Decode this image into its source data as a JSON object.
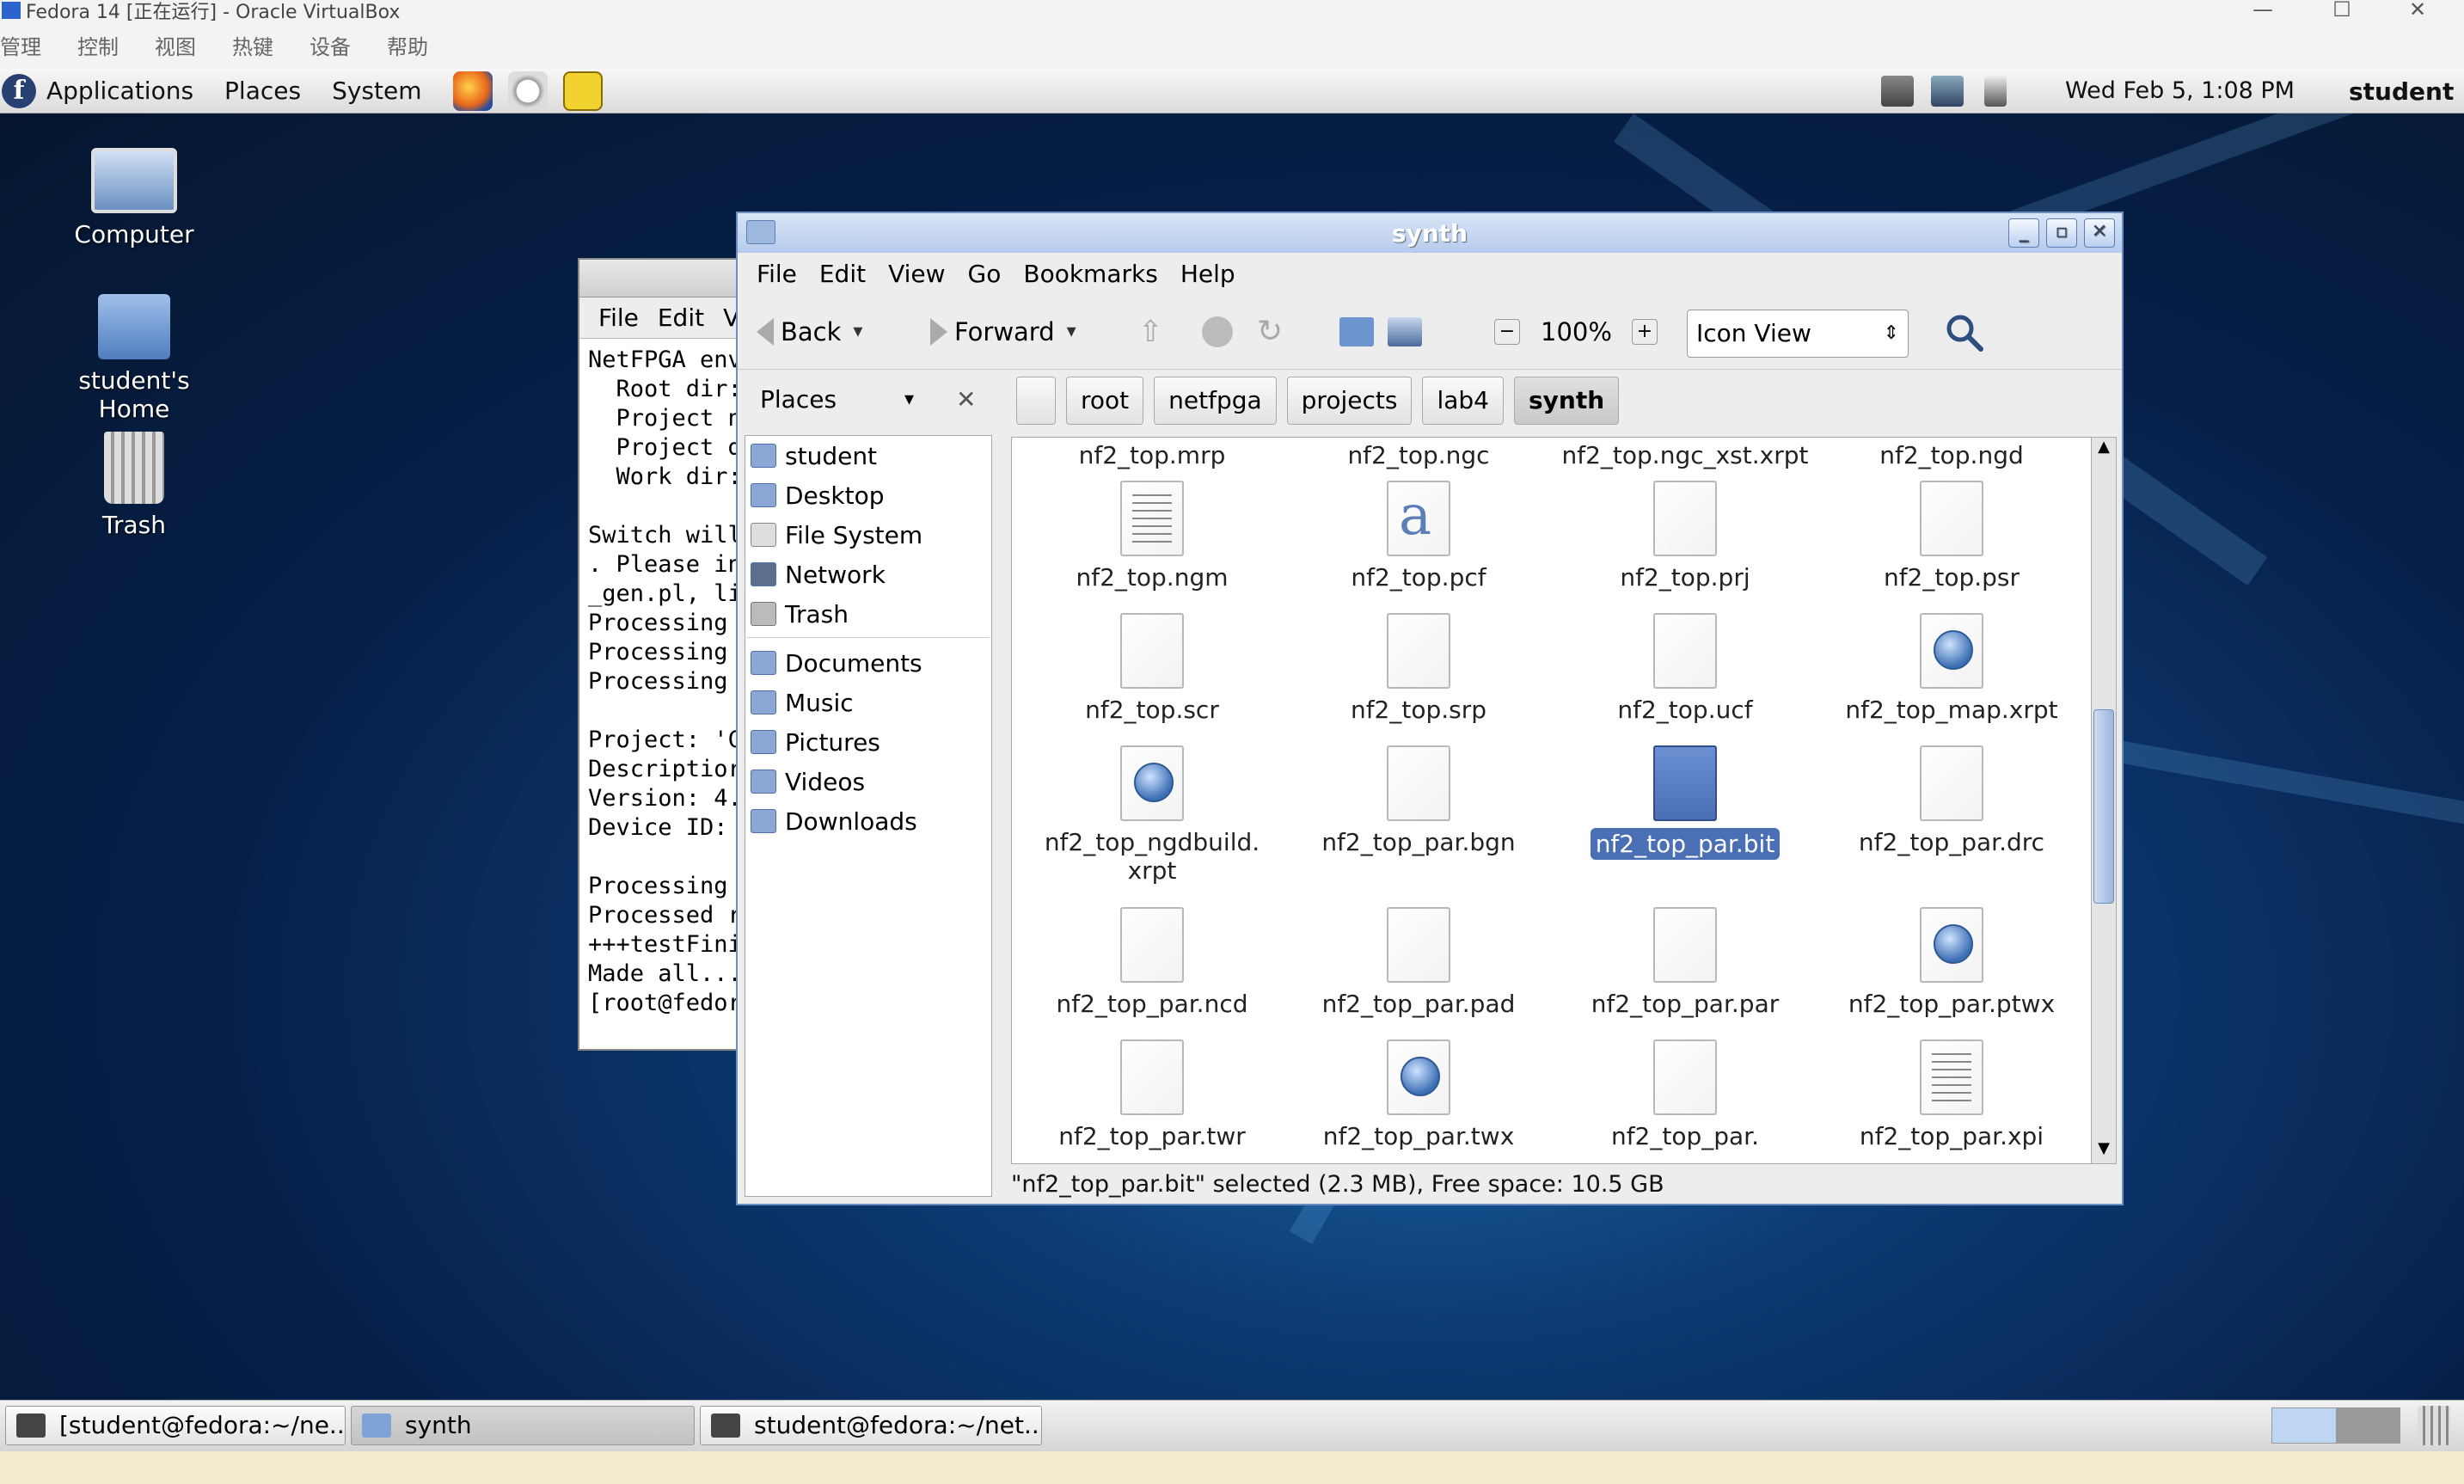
{
  "vbox": {
    "title": "Fedora 14 [正在运行] - Oracle VirtualBox",
    "menu": [
      "管理",
      "控制",
      "视图",
      "热键",
      "设备",
      "帮助"
    ]
  },
  "panel": {
    "menus": [
      "Applications",
      "Places",
      "System"
    ],
    "clock": "Wed Feb  5,  1:08 PM",
    "user": "student"
  },
  "desktop_icons": [
    "Computer",
    "student's Home",
    "Trash"
  ],
  "terminal": {
    "menu": [
      "File",
      "Edit",
      "V"
    ],
    "lines": [
      "NetFPGA env",
      "  Root dir:",
      "  Project n",
      "  Project d",
      "  Work dir:",
      "",
      "Switch will",
      ". Please in",
      "_gen.pl, li",
      "Processing ",
      "Processing ",
      "Processing ",
      "",
      "Project: 'C",
      "Descriptior",
      "Version: 4.",
      "Device ID: ",
      "",
      "Processing ",
      "Processed r",
      "+++testFini",
      "Made all...",
      "[root@fedor"
    ]
  },
  "nautilus": {
    "title": "synth",
    "menu": [
      "File",
      "Edit",
      "View",
      "Go",
      "Bookmarks",
      "Help"
    ],
    "toolbar": {
      "back": "Back",
      "forward": "Forward",
      "zoom": "100%",
      "view": "Icon View"
    },
    "sidebar_title": "Places",
    "sidebar": {
      "group1": [
        "student",
        "Desktop",
        "File System",
        "Network",
        "Trash"
      ],
      "group2": [
        "Documents",
        "Music",
        "Pictures",
        "Videos",
        "Downloads"
      ]
    },
    "path": [
      "root",
      "netfpga",
      "projects",
      "lab4",
      "synth"
    ],
    "files_row0": [
      "nf2_top.mrp",
      "nf2_top.ngc",
      "nf2_top.ngc_xst.xrpt",
      "nf2_top.ngd"
    ],
    "files": [
      {
        "name": "nf2_top.ngm",
        "icon": "lined"
      },
      {
        "name": "nf2_top.pcf",
        "icon": "font"
      },
      {
        "name": "nf2_top.prj",
        "icon": "plain"
      },
      {
        "name": "nf2_top.psr",
        "icon": "plain"
      },
      {
        "name": "nf2_top.scr",
        "icon": "plain"
      },
      {
        "name": "nf2_top.srp",
        "icon": "plain"
      },
      {
        "name": "nf2_top.ucf",
        "icon": "plain"
      },
      {
        "name": "nf2_top_map.xrpt",
        "icon": "globe"
      },
      {
        "name": "nf2_top_ngdbuild.",
        "name2": "xrpt",
        "icon": "globe"
      },
      {
        "name": "nf2_top_par.bgn",
        "icon": "plain"
      },
      {
        "name": "nf2_top_par.bit",
        "icon": "sel",
        "selected": true
      },
      {
        "name": "nf2_top_par.drc",
        "icon": "plain"
      },
      {
        "name": "nf2_top_par.ncd",
        "icon": "plain"
      },
      {
        "name": "nf2_top_par.pad",
        "icon": "plain"
      },
      {
        "name": "nf2_top_par.par",
        "icon": "plain"
      },
      {
        "name": "nf2_top_par.ptwx",
        "icon": "globe"
      },
      {
        "name": "nf2_top_par.twr",
        "icon": "plain"
      },
      {
        "name": "nf2_top_par.twx",
        "icon": "globe"
      },
      {
        "name": "nf2_top_par.",
        "icon": "plain"
      },
      {
        "name": "nf2_top_par.xpi",
        "icon": "lined"
      }
    ],
    "status": "\"nf2_top_par.bit\" selected (2.3 MB), Free space: 10.5 GB"
  },
  "taskbar": [
    "[student@fedora:~/ne...",
    "synth",
    "student@fedora:~/net..."
  ]
}
